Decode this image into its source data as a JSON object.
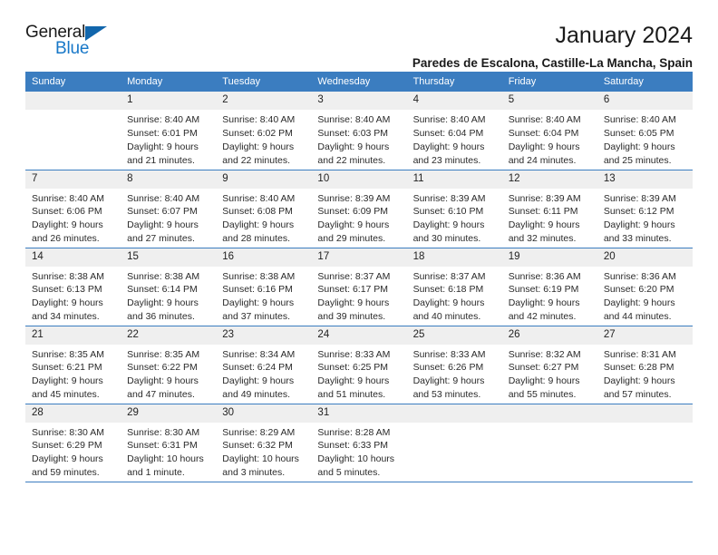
{
  "brand": {
    "name_part1": "General",
    "name_part2": "Blue"
  },
  "header": {
    "month_title": "January 2024",
    "location": "Paredes de Escalona, Castille-La Mancha, Spain"
  },
  "theme": {
    "header_blue": "#3B7DC0",
    "daynum_band": "#EFEFEF",
    "brand_blue": "#1878c8",
    "text": "#2a2a2a"
  },
  "weekdays": [
    "Sunday",
    "Monday",
    "Tuesday",
    "Wednesday",
    "Thursday",
    "Friday",
    "Saturday"
  ],
  "labels": {
    "sunrise_prefix": "Sunrise:",
    "sunset_prefix": "Sunset:",
    "daylight_prefix": "Daylight:"
  },
  "weeks": [
    [
      {
        "day": "",
        "blank": true,
        "sunrise": "",
        "sunset": "",
        "daylight_line1": "",
        "daylight_line2": ""
      },
      {
        "day": "1",
        "sunrise": "Sunrise: 8:40 AM",
        "sunset": "Sunset: 6:01 PM",
        "daylight_line1": "Daylight: 9 hours",
        "daylight_line2": "and 21 minutes."
      },
      {
        "day": "2",
        "sunrise": "Sunrise: 8:40 AM",
        "sunset": "Sunset: 6:02 PM",
        "daylight_line1": "Daylight: 9 hours",
        "daylight_line2": "and 22 minutes."
      },
      {
        "day": "3",
        "sunrise": "Sunrise: 8:40 AM",
        "sunset": "Sunset: 6:03 PM",
        "daylight_line1": "Daylight: 9 hours",
        "daylight_line2": "and 22 minutes."
      },
      {
        "day": "4",
        "sunrise": "Sunrise: 8:40 AM",
        "sunset": "Sunset: 6:04 PM",
        "daylight_line1": "Daylight: 9 hours",
        "daylight_line2": "and 23 minutes."
      },
      {
        "day": "5",
        "sunrise": "Sunrise: 8:40 AM",
        "sunset": "Sunset: 6:04 PM",
        "daylight_line1": "Daylight: 9 hours",
        "daylight_line2": "and 24 minutes."
      },
      {
        "day": "6",
        "sunrise": "Sunrise: 8:40 AM",
        "sunset": "Sunset: 6:05 PM",
        "daylight_line1": "Daylight: 9 hours",
        "daylight_line2": "and 25 minutes."
      }
    ],
    [
      {
        "day": "7",
        "sunrise": "Sunrise: 8:40 AM",
        "sunset": "Sunset: 6:06 PM",
        "daylight_line1": "Daylight: 9 hours",
        "daylight_line2": "and 26 minutes."
      },
      {
        "day": "8",
        "sunrise": "Sunrise: 8:40 AM",
        "sunset": "Sunset: 6:07 PM",
        "daylight_line1": "Daylight: 9 hours",
        "daylight_line2": "and 27 minutes."
      },
      {
        "day": "9",
        "sunrise": "Sunrise: 8:40 AM",
        "sunset": "Sunset: 6:08 PM",
        "daylight_line1": "Daylight: 9 hours",
        "daylight_line2": "and 28 minutes."
      },
      {
        "day": "10",
        "sunrise": "Sunrise: 8:39 AM",
        "sunset": "Sunset: 6:09 PM",
        "daylight_line1": "Daylight: 9 hours",
        "daylight_line2": "and 29 minutes."
      },
      {
        "day": "11",
        "sunrise": "Sunrise: 8:39 AM",
        "sunset": "Sunset: 6:10 PM",
        "daylight_line1": "Daylight: 9 hours",
        "daylight_line2": "and 30 minutes."
      },
      {
        "day": "12",
        "sunrise": "Sunrise: 8:39 AM",
        "sunset": "Sunset: 6:11 PM",
        "daylight_line1": "Daylight: 9 hours",
        "daylight_line2": "and 32 minutes."
      },
      {
        "day": "13",
        "sunrise": "Sunrise: 8:39 AM",
        "sunset": "Sunset: 6:12 PM",
        "daylight_line1": "Daylight: 9 hours",
        "daylight_line2": "and 33 minutes."
      }
    ],
    [
      {
        "day": "14",
        "sunrise": "Sunrise: 8:38 AM",
        "sunset": "Sunset: 6:13 PM",
        "daylight_line1": "Daylight: 9 hours",
        "daylight_line2": "and 34 minutes."
      },
      {
        "day": "15",
        "sunrise": "Sunrise: 8:38 AM",
        "sunset": "Sunset: 6:14 PM",
        "daylight_line1": "Daylight: 9 hours",
        "daylight_line2": "and 36 minutes."
      },
      {
        "day": "16",
        "sunrise": "Sunrise: 8:38 AM",
        "sunset": "Sunset: 6:16 PM",
        "daylight_line1": "Daylight: 9 hours",
        "daylight_line2": "and 37 minutes."
      },
      {
        "day": "17",
        "sunrise": "Sunrise: 8:37 AM",
        "sunset": "Sunset: 6:17 PM",
        "daylight_line1": "Daylight: 9 hours",
        "daylight_line2": "and 39 minutes."
      },
      {
        "day": "18",
        "sunrise": "Sunrise: 8:37 AM",
        "sunset": "Sunset: 6:18 PM",
        "daylight_line1": "Daylight: 9 hours",
        "daylight_line2": "and 40 minutes."
      },
      {
        "day": "19",
        "sunrise": "Sunrise: 8:36 AM",
        "sunset": "Sunset: 6:19 PM",
        "daylight_line1": "Daylight: 9 hours",
        "daylight_line2": "and 42 minutes."
      },
      {
        "day": "20",
        "sunrise": "Sunrise: 8:36 AM",
        "sunset": "Sunset: 6:20 PM",
        "daylight_line1": "Daylight: 9 hours",
        "daylight_line2": "and 44 minutes."
      }
    ],
    [
      {
        "day": "21",
        "sunrise": "Sunrise: 8:35 AM",
        "sunset": "Sunset: 6:21 PM",
        "daylight_line1": "Daylight: 9 hours",
        "daylight_line2": "and 45 minutes."
      },
      {
        "day": "22",
        "sunrise": "Sunrise: 8:35 AM",
        "sunset": "Sunset: 6:22 PM",
        "daylight_line1": "Daylight: 9 hours",
        "daylight_line2": "and 47 minutes."
      },
      {
        "day": "23",
        "sunrise": "Sunrise: 8:34 AM",
        "sunset": "Sunset: 6:24 PM",
        "daylight_line1": "Daylight: 9 hours",
        "daylight_line2": "and 49 minutes."
      },
      {
        "day": "24",
        "sunrise": "Sunrise: 8:33 AM",
        "sunset": "Sunset: 6:25 PM",
        "daylight_line1": "Daylight: 9 hours",
        "daylight_line2": "and 51 minutes."
      },
      {
        "day": "25",
        "sunrise": "Sunrise: 8:33 AM",
        "sunset": "Sunset: 6:26 PM",
        "daylight_line1": "Daylight: 9 hours",
        "daylight_line2": "and 53 minutes."
      },
      {
        "day": "26",
        "sunrise": "Sunrise: 8:32 AM",
        "sunset": "Sunset: 6:27 PM",
        "daylight_line1": "Daylight: 9 hours",
        "daylight_line2": "and 55 minutes."
      },
      {
        "day": "27",
        "sunrise": "Sunrise: 8:31 AM",
        "sunset": "Sunset: 6:28 PM",
        "daylight_line1": "Daylight: 9 hours",
        "daylight_line2": "and 57 minutes."
      }
    ],
    [
      {
        "day": "28",
        "sunrise": "Sunrise: 8:30 AM",
        "sunset": "Sunset: 6:29 PM",
        "daylight_line1": "Daylight: 9 hours",
        "daylight_line2": "and 59 minutes."
      },
      {
        "day": "29",
        "sunrise": "Sunrise: 8:30 AM",
        "sunset": "Sunset: 6:31 PM",
        "daylight_line1": "Daylight: 10 hours",
        "daylight_line2": "and 1 minute."
      },
      {
        "day": "30",
        "sunrise": "Sunrise: 8:29 AM",
        "sunset": "Sunset: 6:32 PM",
        "daylight_line1": "Daylight: 10 hours",
        "daylight_line2": "and 3 minutes."
      },
      {
        "day": "31",
        "sunrise": "Sunrise: 8:28 AM",
        "sunset": "Sunset: 6:33 PM",
        "daylight_line1": "Daylight: 10 hours",
        "daylight_line2": "and 5 minutes."
      },
      {
        "day": "",
        "blank": true,
        "sunrise": "",
        "sunset": "",
        "daylight_line1": "",
        "daylight_line2": ""
      },
      {
        "day": "",
        "blank": true,
        "sunrise": "",
        "sunset": "",
        "daylight_line1": "",
        "daylight_line2": ""
      },
      {
        "day": "",
        "blank": true,
        "sunrise": "",
        "sunset": "",
        "daylight_line1": "",
        "daylight_line2": ""
      }
    ]
  ]
}
